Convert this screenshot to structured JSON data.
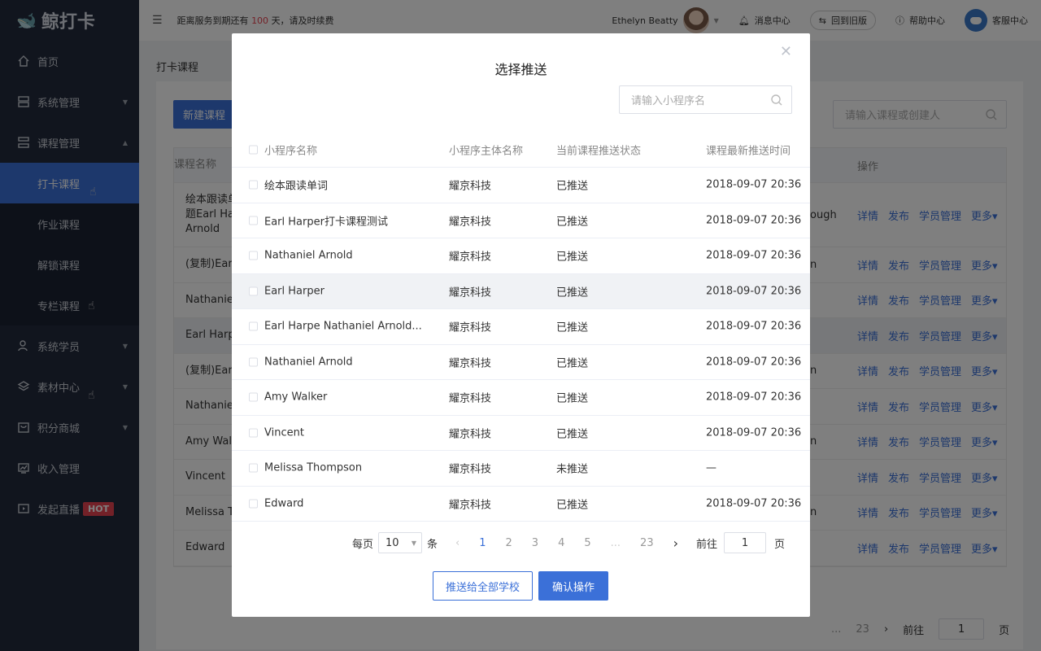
{
  "app": {
    "logo_text": "鲸打卡"
  },
  "header": {
    "notice_prefix": "距离服务到期还有",
    "notice_days": "100",
    "notice_suffix": "天，请及时续费",
    "username": "Ethelyn Beatty",
    "messages": "消息中心",
    "old_version": "回到旧版",
    "help": "帮助中心",
    "service": "客服中心"
  },
  "sidebar": {
    "items": [
      {
        "label": "首页"
      },
      {
        "label": "系统管理"
      },
      {
        "label": "课程管理"
      },
      {
        "label": "系统学员"
      },
      {
        "label": "素材中心"
      },
      {
        "label": "积分商城"
      },
      {
        "label": "收入管理"
      },
      {
        "label": "发起直播",
        "badge": "HOT"
      }
    ],
    "course_sub": [
      "打卡课程",
      "作业课程",
      "解锁课程",
      "专栏课程"
    ]
  },
  "page": {
    "title": "打卡课程",
    "new_button": "新建课程",
    "search_placeholder": "请输入课程或创建人",
    "table_head": {
      "name": "课程名称",
      "ops": "操作"
    },
    "rows": [
      {
        "name_lines": [
          "绘本跟读单",
          "题Earl Har",
          "Arnold"
        ],
        "c2": "ough"
      },
      {
        "name_lines": [
          "(复制)Earl"
        ],
        "c2": "n"
      },
      {
        "name_lines": [
          "Nathaniel"
        ],
        "c2": ""
      },
      {
        "name_lines": [
          "Earl Harpe"
        ],
        "c2": ""
      },
      {
        "name_lines": [
          "(复制)Earl"
        ],
        "c2": "n"
      },
      {
        "name_lines": [
          "Nathaniel"
        ],
        "c2": ""
      },
      {
        "name_lines": [
          "Amy Walk"
        ],
        "c2": "n"
      },
      {
        "name_lines": [
          "Vincent"
        ],
        "c2": ""
      },
      {
        "name_lines": [
          "Melissa Th"
        ],
        "c2": "n"
      },
      {
        "name_lines": [
          "Edward"
        ],
        "c2": ""
      }
    ],
    "ops": {
      "detail": "详情",
      "publish": "发布",
      "students": "学员管理",
      "more": "更多▾"
    },
    "pager": {
      "ellipsis": "...",
      "last": "23",
      "goto": "前往",
      "goto_value": "1",
      "page_unit": "页"
    }
  },
  "modal": {
    "title": "选择推送",
    "search_placeholder": "请输入小程序名",
    "columns": [
      "小程序名称",
      "小程序主体名称",
      "当前课程推送状态",
      "课程最新推送时间"
    ],
    "rows": [
      {
        "name": "绘本跟读单词",
        "entity": "耀京科技",
        "status": "已推送",
        "time": "2018-09-07 20:36"
      },
      {
        "name": "Earl Harper打卡课程测试",
        "entity": "耀京科技",
        "status": "已推送",
        "time": "2018-09-07 20:36"
      },
      {
        "name": "Nathaniel Arnold",
        "entity": "耀京科技",
        "status": "已推送",
        "time": "2018-09-07 20:36"
      },
      {
        "name": "Earl Harper",
        "entity": "耀京科技",
        "status": "已推送",
        "time": "2018-09-07 20:36"
      },
      {
        "name": "Earl Harpe Nathaniel Arnold...",
        "entity": "耀京科技",
        "status": "已推送",
        "time": "2018-09-07 20:36"
      },
      {
        "name": "Nathaniel Arnold",
        "entity": "耀京科技",
        "status": "已推送",
        "time": "2018-09-07 20:36"
      },
      {
        "name": "Amy Walker",
        "entity": "耀京科技",
        "status": "已推送",
        "time": "2018-09-07 20:36"
      },
      {
        "name": "Vincent",
        "entity": "耀京科技",
        "status": "已推送",
        "time": "2018-09-07 20:36"
      },
      {
        "name": "Melissa Thompson",
        "entity": "耀京科技",
        "status": "未推送",
        "time": "—"
      },
      {
        "name": "Edward",
        "entity": "耀京科技",
        "status": "已推送",
        "time": "2018-09-07 20:36"
      }
    ],
    "pager": {
      "per_page_label": "每页",
      "per_page_value": "10",
      "per_page_unit": "条",
      "pages": [
        "1",
        "2",
        "3",
        "4",
        "5",
        "...",
        "23"
      ],
      "goto": "前往",
      "goto_value": "1",
      "page_unit": "页"
    },
    "btn_push_all": "推送给全部学校",
    "btn_confirm": "确认操作"
  },
  "colors": {
    "primary": "#3b70d8",
    "sidebar": "#222a3c",
    "hot": "#e64350"
  }
}
